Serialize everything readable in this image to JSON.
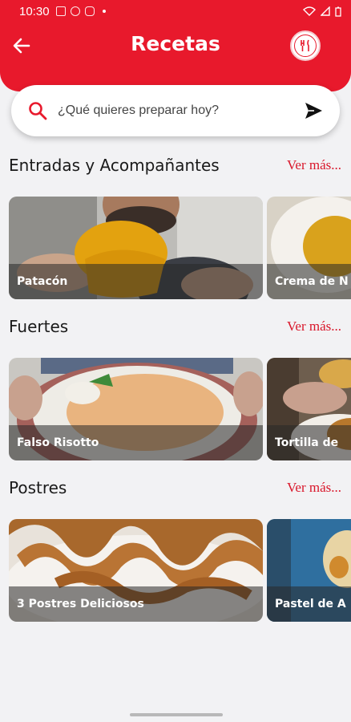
{
  "status": {
    "time": "10:30"
  },
  "header": {
    "title": "Recetas"
  },
  "search": {
    "placeholder": "¿Qué quieres preparar hoy?"
  },
  "sections": [
    {
      "title": "Entradas y Acompañantes",
      "more": "Ver más...",
      "cards": [
        {
          "label": "Patacón"
        },
        {
          "label": "Crema de N"
        }
      ]
    },
    {
      "title": "Fuertes",
      "more": "Ver más...",
      "cards": [
        {
          "label": "Falso Risotto"
        },
        {
          "label": "Tortilla de"
        }
      ]
    },
    {
      "title": "Postres",
      "more": "Ver más...",
      "cards": [
        {
          "label": "3 Postres Deliciosos"
        },
        {
          "label": "Pastel de A"
        }
      ]
    }
  ],
  "colors": {
    "brand": "#e8192c",
    "link": "#d9162a",
    "background": "#f2f2f4"
  }
}
